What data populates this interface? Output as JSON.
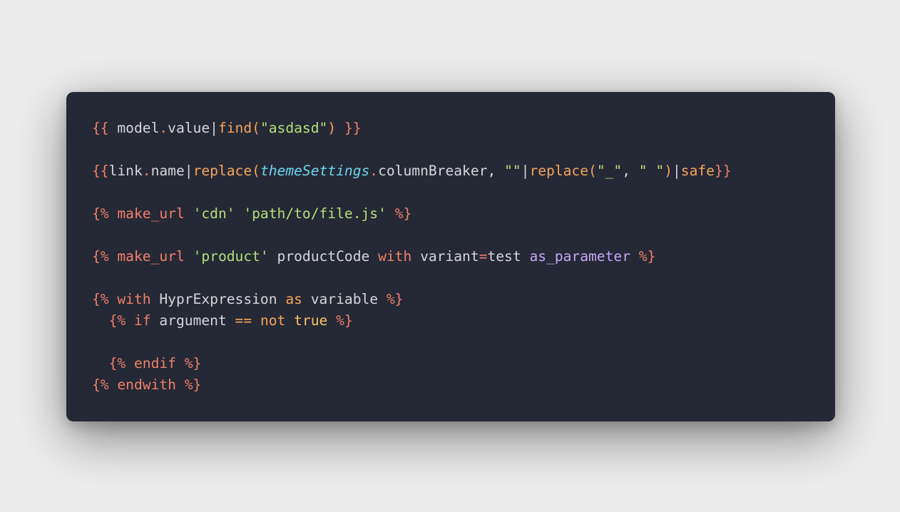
{
  "colors": {
    "background": "#ececec",
    "card": "#252835",
    "default_text": "#d6d6dc",
    "delimiter": "#f0806a",
    "filter": "#f6a55c",
    "string": "#b2e07b",
    "keyword": "#f0806a",
    "italic_var": "#6cd6f0",
    "parameter": "#c7a6f5",
    "literal": "#f6c46a"
  },
  "code": {
    "lines": [
      [
        {
          "t": "{{ ",
          "c": "delimiter"
        },
        {
          "t": "model",
          "c": "default_text"
        },
        {
          "t": ".",
          "c": "delimiter"
        },
        {
          "t": "value",
          "c": "default_text"
        },
        {
          "t": "|",
          "c": "default_text"
        },
        {
          "t": "find(",
          "c": "filter"
        },
        {
          "t": "\"asdasd\"",
          "c": "string"
        },
        {
          "t": ") ",
          "c": "filter"
        },
        {
          "t": "}}",
          "c": "delimiter"
        }
      ],
      [],
      [
        {
          "t": "{{",
          "c": "delimiter"
        },
        {
          "t": "link",
          "c": "default_text"
        },
        {
          "t": ".",
          "c": "delimiter"
        },
        {
          "t": "name",
          "c": "default_text"
        },
        {
          "t": "|",
          "c": "default_text"
        },
        {
          "t": "replace(",
          "c": "filter"
        },
        {
          "t": "themeSettings",
          "c": "italic_var",
          "i": true
        },
        {
          "t": ".",
          "c": "delimiter"
        },
        {
          "t": "columnBreaker",
          "c": "default_text"
        },
        {
          "t": ", ",
          "c": "default_text"
        },
        {
          "t": "\"\"",
          "c": "string"
        },
        {
          "t": "|",
          "c": "default_text"
        },
        {
          "t": "replace(",
          "c": "filter"
        },
        {
          "t": "\"_\"",
          "c": "string"
        },
        {
          "t": ", ",
          "c": "default_text"
        },
        {
          "t": "\" \"",
          "c": "string"
        },
        {
          "t": ")",
          "c": "filter"
        },
        {
          "t": "|",
          "c": "default_text"
        },
        {
          "t": "safe",
          "c": "filter"
        },
        {
          "t": "}}",
          "c": "delimiter"
        }
      ],
      [],
      [
        {
          "t": "{% ",
          "c": "delimiter"
        },
        {
          "t": "make_url",
          "c": "keyword"
        },
        {
          "t": " ",
          "c": "default_text"
        },
        {
          "t": "'cdn'",
          "c": "string"
        },
        {
          "t": " ",
          "c": "default_text"
        },
        {
          "t": "'path/to/file.js'",
          "c": "string"
        },
        {
          "t": " ",
          "c": "default_text"
        },
        {
          "t": "%}",
          "c": "delimiter"
        }
      ],
      [],
      [
        {
          "t": "{% ",
          "c": "delimiter"
        },
        {
          "t": "make_url",
          "c": "keyword"
        },
        {
          "t": " ",
          "c": "default_text"
        },
        {
          "t": "'product'",
          "c": "string"
        },
        {
          "t": " productCode ",
          "c": "default_text"
        },
        {
          "t": "with",
          "c": "keyword"
        },
        {
          "t": " variant",
          "c": "default_text"
        },
        {
          "t": "=",
          "c": "delimiter"
        },
        {
          "t": "test ",
          "c": "default_text"
        },
        {
          "t": "as_parameter",
          "c": "parameter"
        },
        {
          "t": " ",
          "c": "default_text"
        },
        {
          "t": "%}",
          "c": "delimiter"
        }
      ],
      [],
      [
        {
          "t": "{% ",
          "c": "delimiter"
        },
        {
          "t": "with",
          "c": "keyword"
        },
        {
          "t": " HyprExpression ",
          "c": "default_text"
        },
        {
          "t": "as",
          "c": "filter"
        },
        {
          "t": " variable ",
          "c": "default_text"
        },
        {
          "t": "%}",
          "c": "delimiter"
        }
      ],
      [
        {
          "t": "  ",
          "c": "default_text"
        },
        {
          "t": "{% ",
          "c": "delimiter"
        },
        {
          "t": "if",
          "c": "keyword"
        },
        {
          "t": " argument ",
          "c": "default_text"
        },
        {
          "t": "==",
          "c": "filter"
        },
        {
          "t": " ",
          "c": "default_text"
        },
        {
          "t": "not",
          "c": "filter"
        },
        {
          "t": " ",
          "c": "default_text"
        },
        {
          "t": "true",
          "c": "literal"
        },
        {
          "t": " ",
          "c": "default_text"
        },
        {
          "t": "%}",
          "c": "delimiter"
        }
      ],
      [],
      [
        {
          "t": "  ",
          "c": "default_text"
        },
        {
          "t": "{% ",
          "c": "delimiter"
        },
        {
          "t": "endif",
          "c": "keyword"
        },
        {
          "t": " ",
          "c": "default_text"
        },
        {
          "t": "%}",
          "c": "delimiter"
        }
      ],
      [
        {
          "t": "{% ",
          "c": "delimiter"
        },
        {
          "t": "endwith",
          "c": "keyword"
        },
        {
          "t": " ",
          "c": "default_text"
        },
        {
          "t": "%}",
          "c": "delimiter"
        }
      ]
    ]
  }
}
